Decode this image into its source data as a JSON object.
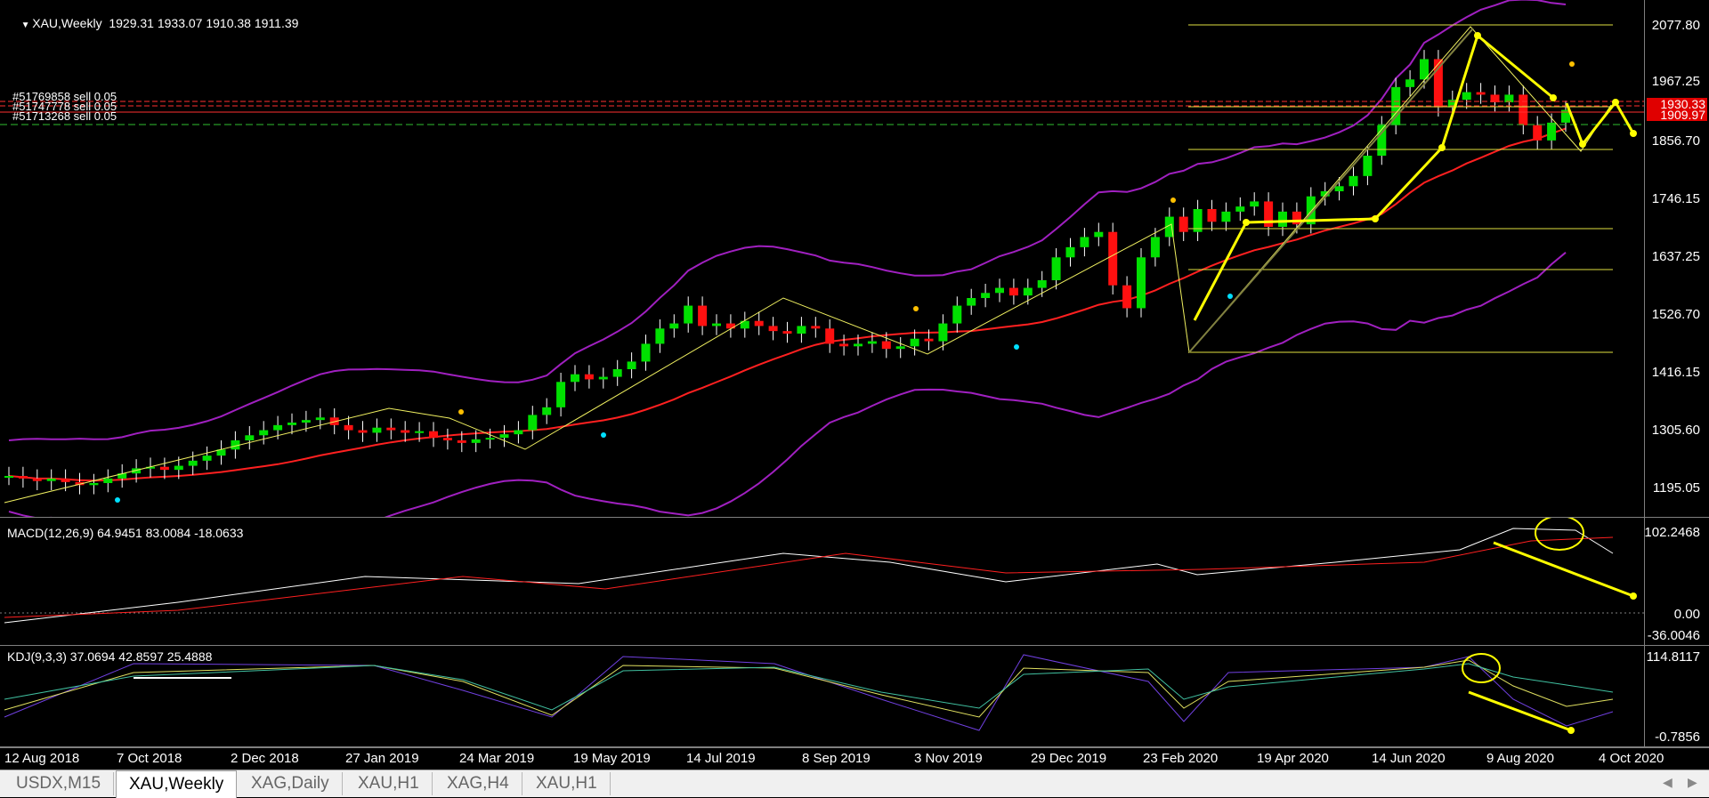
{
  "main": {
    "symbol": "XAU,Weekly",
    "ohlc": "1929.31 1933.07 1910.38 1911.39",
    "price_ticks": [
      "2077.80",
      "1967.25",
      "1856.70",
      "1746.15",
      "1637.25",
      "1526.70",
      "1416.15",
      "1305.60",
      "1195.05"
    ],
    "current_price_red": "1930.33",
    "current_price_red2": "1909.97",
    "orders": [
      "#51769858 sell 0.05",
      "#51747778 sell 0.05",
      "#51713268 sell 0.05"
    ]
  },
  "macd": {
    "label": "MACD(12,26,9) 64.9451 83.0084 -18.0633",
    "ticks": [
      "102.2468",
      "0.00",
      "-36.0046"
    ]
  },
  "kdj": {
    "label": "KDJ(9,3,3) 37.0694 42.8597 25.4888",
    "ticks": [
      "114.8117",
      "-0.7856"
    ]
  },
  "time_axis": [
    "12 Aug 2018",
    "7 Oct 2018",
    "2 Dec 2018",
    "27 Jan 2019",
    "24 Mar 2019",
    "19 May 2019",
    "14 Jul 2019",
    "8 Sep 2019",
    "3 Nov 2019",
    "29 Dec 2019",
    "23 Feb 2020",
    "19 Apr 2020",
    "14 Jun 2020",
    "9 Aug 2020",
    "4 Oct 2020"
  ],
  "tabs": [
    "USDX,M15",
    "XAU,Weekly",
    "XAG,Daily",
    "XAU,H1",
    "XAG,H4",
    "XAU,H1"
  ],
  "active_tab": "XAU,Weekly",
  "chart_data": [
    {
      "type": "candlestick",
      "title": "XAU,Weekly",
      "ylim": [
        1140,
        2120
      ],
      "candles_close_approx": [
        1210,
        1205,
        1200,
        1205,
        1198,
        1192,
        1196,
        1205,
        1215,
        1225,
        1228,
        1222,
        1230,
        1240,
        1250,
        1262,
        1280,
        1290,
        1300,
        1310,
        1315,
        1320,
        1325,
        1310,
        1300,
        1295,
        1305,
        1300,
        1295,
        1298,
        1285,
        1280,
        1275,
        1282,
        1285,
        1292,
        1300,
        1330,
        1345,
        1395,
        1410,
        1400,
        1405,
        1420,
        1435,
        1470,
        1500,
        1510,
        1545,
        1505,
        1510,
        1500,
        1515,
        1505,
        1495,
        1490,
        1505,
        1500,
        1470,
        1465,
        1470,
        1475,
        1460,
        1465,
        1480,
        1475,
        1510,
        1545,
        1560,
        1570,
        1580,
        1565,
        1580,
        1595,
        1640,
        1660,
        1680,
        1690,
        1585,
        1540,
        1640,
        1680,
        1720,
        1690,
        1735,
        1710,
        1730,
        1740,
        1750,
        1700,
        1730,
        1705,
        1760,
        1770,
        1780,
        1800,
        1840,
        1900,
        1975,
        1990,
        2030,
        1935,
        1950,
        1965,
        1960,
        1945,
        1960,
        1900,
        1870,
        1905,
        1930
      ],
      "series": [
        {
          "name": "bollinger-upper"
        },
        {
          "name": "bollinger-middle"
        },
        {
          "name": "bollinger-lower"
        }
      ]
    },
    {
      "type": "bar",
      "title": "MACD(12,26,9) 64.9451 83.0084 -18.0633",
      "ylim": [
        -36.0046,
        102.2468
      ]
    },
    {
      "type": "line",
      "title": "KDJ(9,3,3) 37.0694 42.8597 25.4888",
      "ylim": [
        -0.7856,
        114.8117
      ]
    }
  ]
}
